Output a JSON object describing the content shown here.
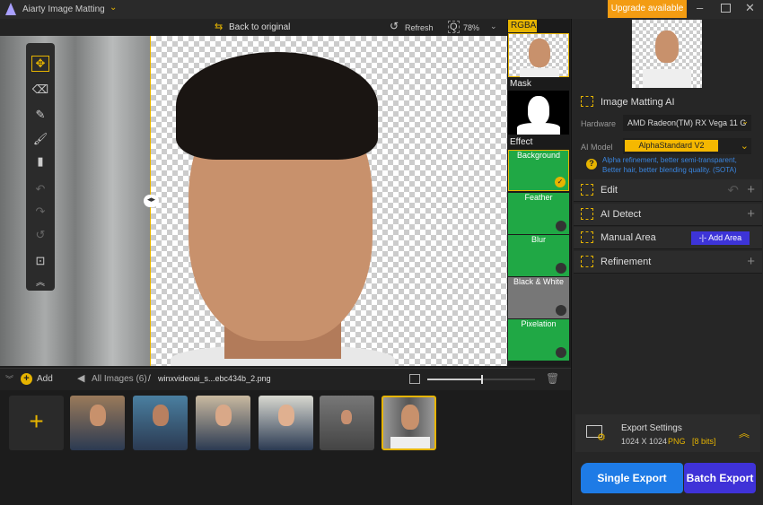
{
  "app": {
    "title": "Aiarty Image Matting",
    "upgrade": "Upgrade available"
  },
  "toolbar": {
    "back": "Back to original",
    "refresh": "Refresh",
    "zoom": "78%"
  },
  "strip": {
    "rgba": "RGBA",
    "mask": "Mask",
    "effect": "Effect",
    "effects": [
      "Background",
      "Feather",
      "Blur",
      "Black & White",
      "Pixelation"
    ]
  },
  "panel": {
    "matting_title": "Image Matting AI",
    "hardware_label": "Hardware",
    "hardware_value": "AMD Radeon(TM) RX Vega 11 G",
    "model_label": "AI Model",
    "model_value": "AlphaStandard  V2",
    "model_desc": "Alpha refinement, better semi-transparent, Better hair, better blending quality. (SOTA)",
    "sections": [
      "Edit",
      "AI Detect",
      "Manual Area",
      "Refinement"
    ],
    "add_area": "Add Area"
  },
  "export": {
    "title": "Export Settings",
    "size": "1024 X 1024",
    "format": "PNG",
    "bits": "[8 bits]",
    "single": "Single Export",
    "batch": "Batch Export"
  },
  "bottom": {
    "add": "Add",
    "all_images": "All Images (6)",
    "sep": "/",
    "filename": "winxvideoai_s...ebc434b_2.png",
    "zoom_slider": 0.5
  },
  "colors": {
    "accent": "#e6b400",
    "orange": "#f39c12",
    "green": "#20a845",
    "blue": "#1e7be6",
    "purple": "#3f32d8"
  }
}
